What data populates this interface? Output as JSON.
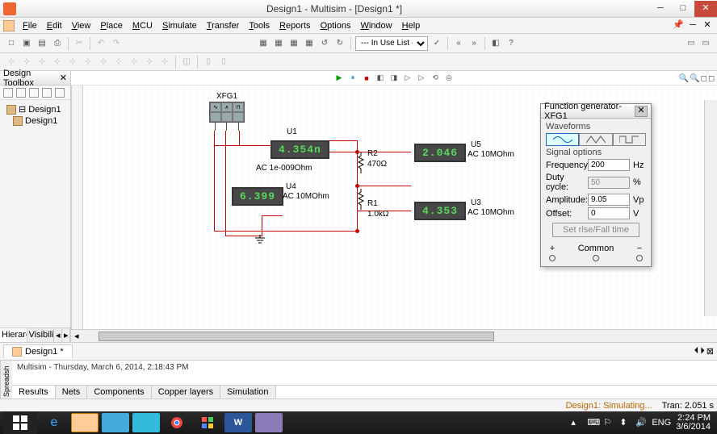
{
  "title": "Design1 - Multisim - [Design1 *]",
  "menu": [
    "File",
    "Edit",
    "View",
    "Place",
    "MCU",
    "Simulate",
    "Transfer",
    "Tools",
    "Reports",
    "Options",
    "Window",
    "Help"
  ],
  "tb_select": "--- In Use List ---",
  "sidebar": {
    "title": "Design Toolbox",
    "tree": [
      "Design1",
      "Design1"
    ],
    "tabs": [
      "Hierarchy",
      "Visibilit"
    ]
  },
  "xfg_label": "XFG1",
  "meters": {
    "u1": {
      "name": "U1",
      "val": "4.354n",
      "mode": "AC  1e-009Ohm"
    },
    "u4": {
      "name": "U4",
      "val": "6.399",
      "mode": "AC  10MOhm"
    },
    "u5": {
      "name": "U5",
      "val": "2.046",
      "mode": "AC  10MOhm"
    },
    "u3": {
      "name": "U3",
      "val": "4.353",
      "mode": "AC  10MOhm"
    }
  },
  "res": {
    "r1": {
      "name": "R1",
      "val": "1.0kΩ"
    },
    "r2": {
      "name": "R2",
      "val": "470Ω"
    }
  },
  "fgen": {
    "title": "Function generator-XFG1",
    "sec1": "Waveforms",
    "sec2": "Signal options",
    "freq_l": "Frequency:",
    "freq_v": "200",
    "freq_u": "Hz",
    "duty_l": "Duty cycle:",
    "duty_v": "50",
    "duty_u": "%",
    "amp_l": "Amplitude:",
    "amp_v": "9.05",
    "amp_u": "Vp",
    "off_l": "Offset:",
    "off_v": "0",
    "off_u": "V",
    "btn": "Set rise/Fall time",
    "t_plus": "+",
    "t_com": "Common",
    "t_min": "−"
  },
  "doctab": "Design1 *",
  "info": "Multisim  -  Thursday, March 6, 2014, 2:18:43 PM",
  "btabs": [
    "Results",
    "Nets",
    "Components",
    "Copper layers",
    "Simulation"
  ],
  "status": {
    "sim": "Design1: Simulating...",
    "tran": "Tran: 2.051 s"
  },
  "tray": {
    "lang": "ENG",
    "time": "2:24 PM",
    "date": "3/6/2014"
  }
}
